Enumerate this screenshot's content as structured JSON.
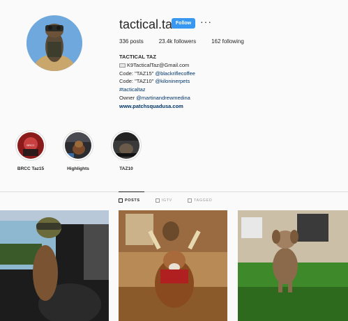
{
  "profile": {
    "username": "tactical.taz",
    "follow_label": "Follow",
    "more_label": "···",
    "stats": {
      "posts": "336 posts",
      "followers": "23.4k followers",
      "following": "162 following"
    },
    "bio": {
      "name": "TACTICAL TAZ",
      "email": "K9TacticalTaz@Gmail.com",
      "line_code1_prefix": "Code: \"TAZ15\" ",
      "line_code1_handle": "@blackriflecoffee",
      "line_code2_prefix": "Code: \"TAZ10\" ",
      "line_code2_handle": "@kiloninerpets",
      "hashtag": "#tacticaltaz",
      "owner_prefix": "Owner ",
      "owner_handle": "@martinandrewmedina",
      "website": "www.patchsquadusa.com"
    }
  },
  "highlights": [
    {
      "label": "BRCC Taz15",
      "icon": "highlight-brcc"
    },
    {
      "label": "Highlights",
      "icon": "highlight-dog"
    },
    {
      "label": "TAZ10",
      "icon": "highlight-taz10"
    }
  ],
  "tabs": [
    {
      "label": "POSTS",
      "icon": "grid-icon",
      "active": true
    },
    {
      "label": "IGTV",
      "icon": "tv-icon",
      "active": false
    },
    {
      "label": "TAGGED",
      "icon": "tag-icon",
      "active": false
    }
  ],
  "colors": {
    "follow_button": "#3897f0",
    "background": "#fafafa",
    "link": "#003569"
  }
}
